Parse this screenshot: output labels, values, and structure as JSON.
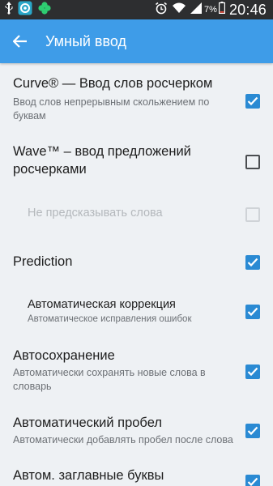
{
  "status_bar": {
    "icons": [
      "usb-icon",
      "sync-app-icon",
      "clover-icon",
      "alarm-icon",
      "wifi-icon",
      "signal-icon",
      "battery-icon"
    ],
    "battery_percent": "7%",
    "time": "20:46"
  },
  "app_bar": {
    "title": "Умный ввод",
    "color": "#3e9ce8"
  },
  "colors": {
    "accent": "#2a8ad3",
    "background": "#eef1f4"
  },
  "settings": [
    {
      "title": "Curve® — Ввод слов росчерком",
      "summary": "Ввод слов непрерывным скольжением по буквам",
      "checked": true,
      "enabled": true
    },
    {
      "title": "Wave™ – ввод предложений росчерками",
      "summary": "",
      "checked": false,
      "enabled": true
    },
    {
      "title": "Не предсказывать слова",
      "summary": "",
      "checked": false,
      "enabled": false
    },
    {
      "title": "Prediction",
      "summary": "",
      "checked": true,
      "enabled": true
    },
    {
      "title": "Автоматическая коррекция",
      "summary": "Автоматическое исправления ошибок",
      "checked": true,
      "enabled": true
    },
    {
      "title": "Автосохранение",
      "summary": "Автоматически сохранять новые слова в словарь",
      "checked": true,
      "enabled": true
    },
    {
      "title": "Автоматический пробел",
      "summary": "Автоматически добавлять пробел после слова",
      "checked": true,
      "enabled": true
    },
    {
      "title": "Автом. заглавные буквы",
      "summary": "",
      "checked": true,
      "enabled": true
    }
  ]
}
